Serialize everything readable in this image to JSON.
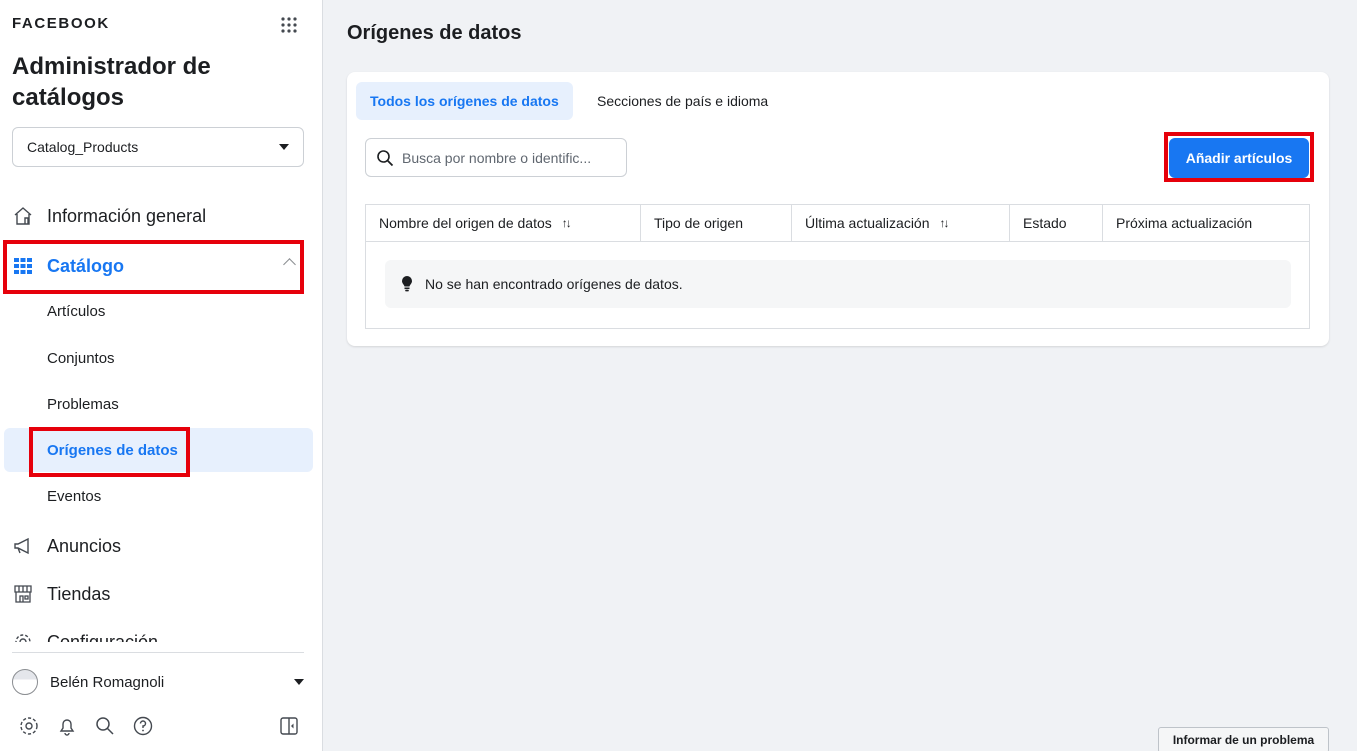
{
  "sidebar": {
    "brand": "FACEBOOK",
    "app_title": "Administrador de catálogos",
    "catalog_selector": {
      "value": "Catalog_Products"
    },
    "nav": {
      "info": "Información general",
      "catalog": "Catálogo",
      "ads": "Anuncios",
      "shops": "Tiendas",
      "settings": "Configuración"
    },
    "catalog_sub": {
      "items": "Artículos",
      "sets": "Conjuntos",
      "issues": "Problemas",
      "data_sources": "Orígenes de datos",
      "events": "Eventos"
    },
    "user": {
      "name": "Belén Romagnoli"
    },
    "bottom_icons": [
      "gear-icon",
      "bell-icon",
      "search-icon",
      "help-icon",
      "panel-toggle-icon"
    ]
  },
  "main": {
    "page_title": "Orígenes de datos",
    "tabs": {
      "all": "Todos los orígenes de datos",
      "country_lang": "Secciones de país e idioma"
    },
    "search": {
      "placeholder": "Busca por nombre o identific..."
    },
    "add_button": "Añadir artículos",
    "table": {
      "columns": {
        "name": "Nombre del origen de datos",
        "type": "Tipo de origen",
        "updated": "Última actualización",
        "status": "Estado",
        "next": "Próxima actualización"
      },
      "empty_message": "No se han encontrado orígenes de datos."
    }
  },
  "footer": {
    "report_problem": "Informar de un problema"
  },
  "colors": {
    "accent": "#1877f2",
    "highlight": "#e6000b",
    "selected_bg": "#e7f0fd"
  }
}
